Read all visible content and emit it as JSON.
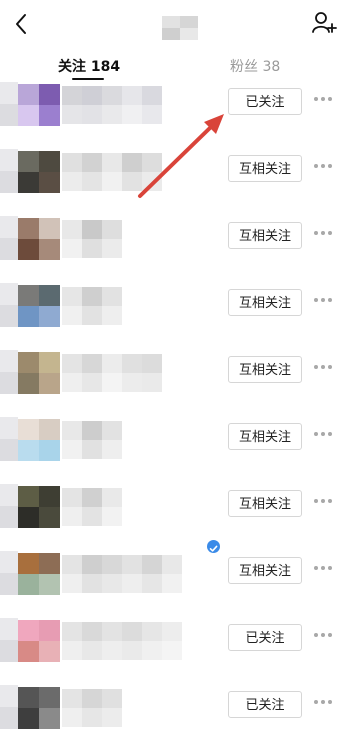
{
  "header": {
    "back_icon": "back-arrow-icon",
    "add_icon": "add-user-icon"
  },
  "tabs": [
    {
      "label": "关注 184",
      "active": true
    },
    {
      "label": "粉丝 38",
      "active": false
    }
  ],
  "rows": [
    {
      "button_label": "已关注",
      "avatar_colors": [
        "#b9a6d8",
        "#7d5cb0",
        "#d8c7ef",
        "#9b7fcf"
      ],
      "name_colors": [
        "#d4d4d8",
        "#cfcfd6",
        "#dadade",
        "#e6e6ea",
        "#d9d9df"
      ]
    },
    {
      "button_label": "互相关注",
      "avatar_colors": [
        "#6a6a60",
        "#4e4a40",
        "#3b3a36",
        "#5a4e44"
      ],
      "name_colors": [
        "#e0e0e0",
        "#d2d2d2",
        "#e8e8e8",
        "#cfcfcf",
        "#dddddd"
      ]
    },
    {
      "button_label": "互相关注",
      "avatar_colors": [
        "#9a7b6a",
        "#d1c2b8",
        "#6d4b3b",
        "#a68a7a"
      ],
      "name_colors": [
        "#e8e8e8",
        "#c9c9c9",
        "#dedede"
      ]
    },
    {
      "button_label": "互相关注",
      "avatar_colors": [
        "#7a7a78",
        "#5b6a70",
        "#6f95c4",
        "#8faad1"
      ],
      "name_colors": [
        "#e6e6e6",
        "#cfcfcf",
        "#e2e2e2"
      ]
    },
    {
      "button_label": "互相关注",
      "avatar_colors": [
        "#9c8a6c",
        "#c4b58f",
        "#857a62",
        "#b9a58a"
      ],
      "name_colors": [
        "#e4e4e4",
        "#d7d7d7",
        "#ececec",
        "#e0e0e0",
        "#dcdcdc"
      ]
    },
    {
      "button_label": "互相关注",
      "avatar_colors": [
        "#e8ded6",
        "#d8cdc3",
        "#b9dcee",
        "#a9d4ea"
      ],
      "name_colors": [
        "#e8e8e8",
        "#cdcdcd",
        "#e2e2e2"
      ]
    },
    {
      "button_label": "互相关注",
      "avatar_colors": [
        "#5d5d45",
        "#3e3e33",
        "#2d2d28",
        "#4a4a3c"
      ],
      "name_colors": [
        "#e4e4e4",
        "#d0d0d0",
        "#e9e9e9"
      ]
    },
    {
      "button_label": "互相关注",
      "avatar_colors": [
        "#a86f3d",
        "#8d6d55",
        "#9ab29c",
        "#b2c3b1"
      ],
      "name_colors": [
        "#e4e4e4",
        "#cfcfcf",
        "#d8d8d8",
        "#e2e2e2",
        "#d5d5d5",
        "#e8e8e8"
      ]
    },
    {
      "button_label": "已关注",
      "avatar_colors": [
        "#f0a7be",
        "#e79cb3",
        "#d88a86",
        "#e8b1b6"
      ],
      "name_colors": [
        "#e4e4e4",
        "#d9d9d9",
        "#e3e3e3",
        "#dcdcdc",
        "#e6e6e6",
        "#ededed"
      ]
    },
    {
      "button_label": "已关注",
      "avatar_colors": [
        "#555555",
        "#6b6b6b",
        "#3e3e3e",
        "#8a8a8a"
      ],
      "name_colors": [
        "#e4e4e4",
        "#d6d6d6",
        "#e0e0e0"
      ]
    }
  ],
  "colors": {
    "annotation_arrow": "#d9443a",
    "verified_badge": "#3b8be8",
    "button_border": "#d6d6d6",
    "tab_inactive": "#9a9a9a"
  }
}
